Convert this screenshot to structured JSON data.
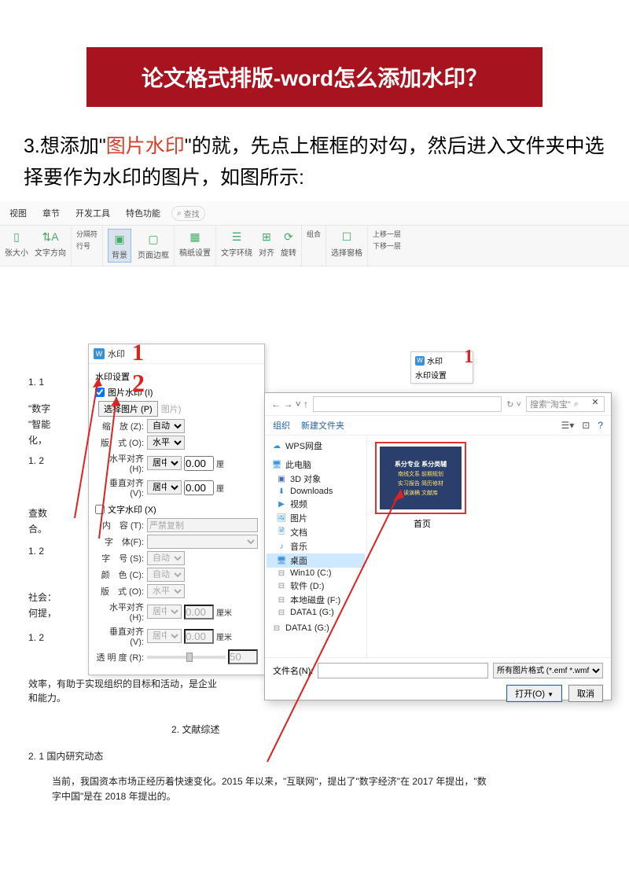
{
  "banner": {
    "title": "论文格式排版-word怎么添加水印？"
  },
  "instruction": {
    "prefix": "3.想添加\"",
    "highlight": "图片水印",
    "suffix": "\"的就，先点上框框的对勾，然后进入文件夹中选择要作为水印的图片，如图所示:"
  },
  "ribbon": {
    "tabs": [
      "视图",
      "章节",
      "开发工具",
      "特色功能"
    ],
    "search_label": "查找",
    "groups": {
      "g1": [
        "张大小",
        "文字方向"
      ],
      "g2": [
        "分隔符",
        "行号"
      ],
      "g3_active": "背景",
      "g3b": "页面边框",
      "g4": "稿纸设置",
      "g5": [
        "文字环绕",
        "对齐",
        "旋转"
      ],
      "g6": "组合",
      "g7": "选择窗格",
      "g8": [
        "上移一层",
        "下移一层"
      ]
    }
  },
  "wm": {
    "title": "水印",
    "section": "水印设置",
    "pic_chk": "图片水印 (I)",
    "pic_btn": "选择图片 (P)",
    "pic_btn_suffix": "图片)",
    "scale": "缩　放 (Z):",
    "scale_val": "自动",
    "layout": "版　式 (O):",
    "layout_val": "水平",
    "halign": "水平对齐 (H):",
    "halign_val": "居中",
    "halign_num": "0.00",
    "unit": "厘",
    "valign": "垂直对齐 (V):",
    "valign_val": "居中",
    "valign_num": "0.00",
    "unit2": "厘",
    "text_chk": "文字水印 (X)",
    "content": "内　容 (T):",
    "content_val": "严禁复制",
    "font": "字　体(F):",
    "size": "字　号 (S):",
    "size_val": "自动",
    "color": "颜　色 (C):",
    "color_val": "自动",
    "layout2": "版　式 (O):",
    "layout2_val": "水平",
    "halign2": "水平对齐 (H):",
    "halign2_val": "居中",
    "halign2_num": "0.00",
    "unit3": "厘米",
    "valign2": "垂直对齐 (V):",
    "valign2_val": "居中",
    "valign2_num": "0.00",
    "unit4": "厘米",
    "opacity": "透 明 度 (R):",
    "opacity_val": "50"
  },
  "wm2": {
    "title": "水印",
    "section": "水印设置"
  },
  "annotations": {
    "one": "1",
    "two": "2"
  },
  "fp": {
    "nav_search_placeholder": "搜索\"淘宝\"",
    "toolbar": {
      "org": "组织",
      "newfolder": "新建文件夹"
    },
    "side": {
      "wps": "WPS网盘",
      "thispc": "此电脑",
      "items": [
        "3D 对象",
        "Downloads",
        "视频",
        "图片",
        "文档",
        "音乐",
        "桌面",
        "Win10 (C:)",
        "软件 (D:)",
        "本地磁盘 (F:)",
        "DATA1 (G:)"
      ],
      "bottom": "DATA1 (G:)"
    },
    "selected": "桌面",
    "thumb": {
      "line1": "系分专业 系分类辅",
      "line2": "南线文系 前期规划",
      "line3": "实习报告 简历修材",
      "line4": "读演稿 文献库",
      "caption": "首页"
    },
    "filename_label": "文件名(N):",
    "filter": "所有图片格式 (*.emf *.wmf *.jp",
    "open_btn": "打开(O)",
    "cancel_btn": "取消"
  },
  "doc": {
    "l1": "1. 1",
    "l2": "\"数字",
    "l3": "\"智能",
    "l4": "化，",
    "l5": "1. 2",
    "l6": "查数",
    "l7": "合。",
    "l8": "1. 2",
    "l9": "社会：",
    "l10": "何提，",
    "l11": "1. 2",
    "l12": "效率，有助于实现组织的目标和活动，是企业",
    "l13": "和能力。",
    "l14": "2. 文献综述",
    "l15": "2. 1 国内研究动态",
    "l16": "当前，我国资本市场正经历着快速变化。2015 年以来，\"互联网\"，提出了\"数字经济\"在 2017 年提出，\"数字中国\"是在 2018 年提出的。"
  }
}
